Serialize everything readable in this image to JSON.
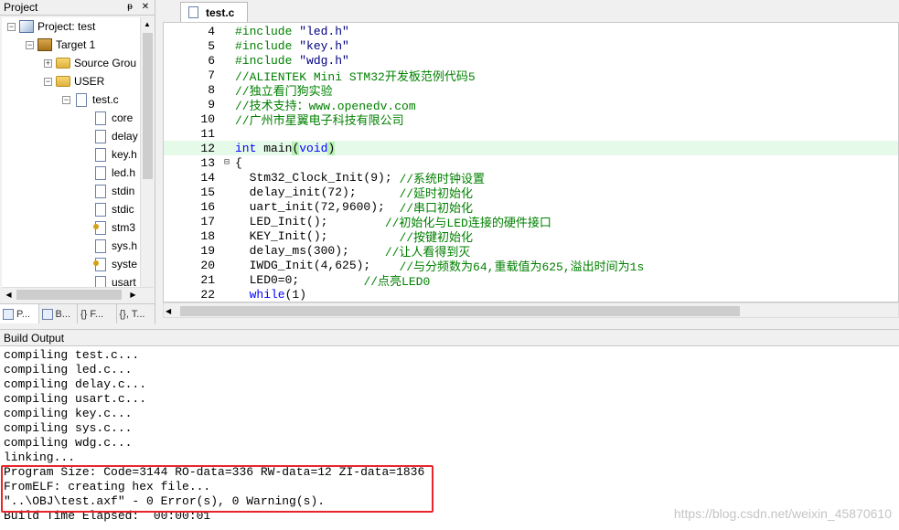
{
  "project": {
    "title": "Project",
    "pin": "ᵽ",
    "close": "✕",
    "tree": {
      "root": "Project: test",
      "target": "Target 1",
      "source_group": "Source Grou",
      "user": "USER",
      "test_c": "test.c",
      "files": [
        "core",
        "delay",
        "key.h",
        "led.h",
        "stdin",
        "stdic",
        "stm3",
        "sys.h",
        "syste",
        "usart"
      ]
    },
    "tabs": [
      "P...",
      "B...",
      "{} F...",
      "{}, T..."
    ]
  },
  "editor": {
    "tab_label": "test.c",
    "lines": [
      {
        "n": "4",
        "parts": [
          [
            "pp",
            "#include "
          ],
          [
            "str",
            "\"led.h\""
          ]
        ]
      },
      {
        "n": "5",
        "parts": [
          [
            "pp",
            "#include "
          ],
          [
            "str",
            "\"key.h\""
          ]
        ]
      },
      {
        "n": "6",
        "parts": [
          [
            "pp",
            "#include "
          ],
          [
            "str",
            "\"wdg.h\""
          ]
        ]
      },
      {
        "n": "7",
        "parts": [
          [
            "cm",
            "//ALIENTEK Mini STM32开发板范例代码5"
          ]
        ]
      },
      {
        "n": "8",
        "parts": [
          [
            "cm",
            "//独立看门狗实验"
          ]
        ]
      },
      {
        "n": "9",
        "parts": [
          [
            "cm",
            "//技术支持：www.openedv.com"
          ]
        ]
      },
      {
        "n": "10",
        "parts": [
          [
            "cm",
            "//广州市星翼电子科技有限公司"
          ]
        ]
      },
      {
        "n": "11",
        "parts": []
      },
      {
        "n": "12",
        "parts": [
          [
            "kw",
            "int "
          ],
          [
            "",
            "main"
          ],
          [
            "paren",
            "("
          ],
          [
            "kw",
            "void"
          ],
          [
            "paren",
            ")"
          ]
        ]
      },
      {
        "n": "13",
        "fold": "⊟",
        "parts": [
          [
            "",
            "{"
          ]
        ]
      },
      {
        "n": "14",
        "parts": [
          [
            "",
            "  Stm32_Clock_Init(9); "
          ],
          [
            "cm",
            "//系统时钟设置"
          ]
        ]
      },
      {
        "n": "15",
        "parts": [
          [
            "",
            "  delay_init(72);      "
          ],
          [
            "cm",
            "//延时初始化"
          ]
        ]
      },
      {
        "n": "16",
        "parts": [
          [
            "",
            "  uart_init(72,9600);  "
          ],
          [
            "cm",
            "//串口初始化"
          ]
        ]
      },
      {
        "n": "17",
        "parts": [
          [
            "",
            "  LED_Init();        "
          ],
          [
            "cm",
            "//初始化与LED连接的硬件接口"
          ]
        ]
      },
      {
        "n": "18",
        "parts": [
          [
            "",
            "  KEY_Init();          "
          ],
          [
            "cm",
            "//按键初始化"
          ]
        ]
      },
      {
        "n": "19",
        "parts": [
          [
            "",
            "  delay_ms(300);     "
          ],
          [
            "cm",
            "//让人看得到灭"
          ]
        ]
      },
      {
        "n": "20",
        "parts": [
          [
            "",
            "  IWDG_Init(4,625);    "
          ],
          [
            "cm",
            "//与分频数为64,重载值为625,溢出时间为1s"
          ]
        ]
      },
      {
        "n": "21",
        "parts": [
          [
            "",
            "  LED0=0;         "
          ],
          [
            "cm",
            "//点亮LED0"
          ]
        ]
      },
      {
        "n": "22",
        "parts": [
          [
            "kw",
            "  while"
          ],
          [
            "",
            "(1)"
          ]
        ]
      }
    ]
  },
  "build": {
    "title": "Build Output",
    "lines": [
      "compiling test.c...",
      "compiling led.c...",
      "compiling delay.c...",
      "compiling usart.c...",
      "compiling key.c...",
      "compiling sys.c...",
      "compiling wdg.c...",
      "linking...",
      "Program Size: Code=3144 RO-data=336 RW-data=12 ZI-data=1836",
      "FromELF: creating hex file...",
      "\"..\\OBJ\\test.axf\" - 0 Error(s), 0 Warning(s).",
      "Build Time Elapsed:  00:00:01"
    ],
    "watermark": "https://blog.csdn.net/weixin_45870610"
  },
  "colors": {
    "highlight_box": "#e8262a",
    "comment": "#008000",
    "keyword": "#0000ff",
    "string": "#000080"
  }
}
